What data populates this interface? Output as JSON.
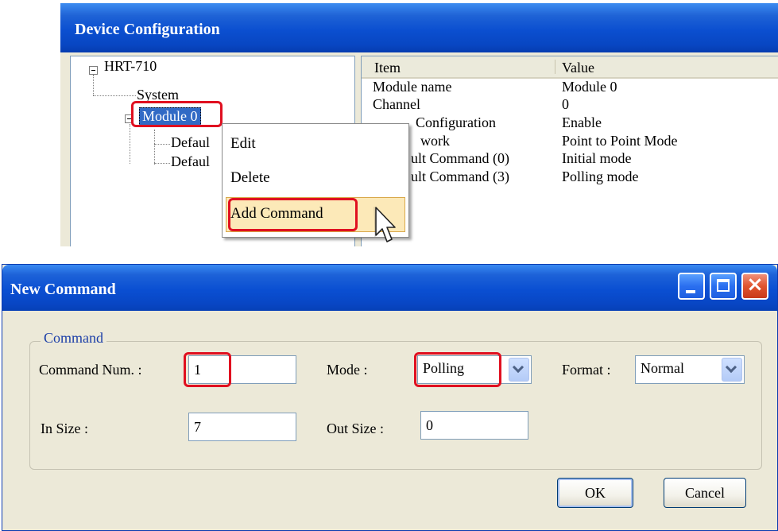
{
  "device_config": {
    "title": "Device Configuration",
    "tree": {
      "root": "HRT-710",
      "system": "System",
      "module": "Module 0",
      "child1": "Defaul",
      "child2": "Defaul"
    },
    "grid": {
      "col_item": "Item",
      "col_value": "Value",
      "rows": [
        {
          "item": "Module name",
          "value": "Module 0"
        },
        {
          "item": "Channel",
          "value": "0"
        },
        {
          "item": "Configuration",
          "value": "Enable"
        },
        {
          "item": "work",
          "value": "Point to Point Mode"
        },
        {
          "item": "ult Command (0)",
          "value": "Initial mode"
        },
        {
          "item": "ult Command (3)",
          "value": "Polling mode"
        }
      ]
    },
    "context_menu": {
      "edit": "Edit",
      "delete": "Delete",
      "add_command": "Add Command"
    }
  },
  "new_command": {
    "title": "New Command",
    "group_label": "Command",
    "command_num_label": "Command Num. :",
    "command_num_value": "1",
    "mode_label": "Mode :",
    "mode_value": "Polling",
    "format_label": "Format :",
    "format_value": "Normal",
    "in_size_label": "In Size :",
    "in_size_value": "7",
    "out_size_label": "Out Size :",
    "out_size_value": "0",
    "ok_label": "OK",
    "cancel_label": "Cancel"
  },
  "colors": {
    "highlight_red": "#e01020",
    "titlebar_blue": "#0b4fd0",
    "selection_blue": "#316ac5"
  }
}
